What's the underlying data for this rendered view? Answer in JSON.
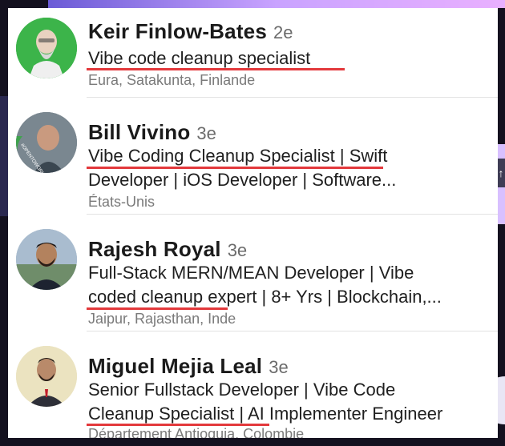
{
  "accent": "#e3393c",
  "results": [
    {
      "name": "Keir Finlow-Bates",
      "degree": "2e",
      "headline": [
        "Vibe code cleanup specialist"
      ],
      "location": "Eura, Satakunta, Finlande",
      "avatar": "bearded-man-green-avatar"
    },
    {
      "name": "Bill Vivino",
      "degree": "3e",
      "headline": [
        "Vibe Coding Cleanup Specialist | Swift",
        "Developer | iOS Developer | Software..."
      ],
      "location": "États-Unis",
      "avatar": "man-open-to-work-avatar",
      "badge": "#OPENTOWORK"
    },
    {
      "name": "Rajesh Royal",
      "degree": "3e",
      "headline": [
        "Full-Stack MERN/MEAN Developer | Vibe",
        "coded cleanup expert | 8+ Yrs | Blockchain,..."
      ],
      "location": "Jaipur, Rajasthan, Inde",
      "avatar": "man-outdoor-avatar"
    },
    {
      "name": "Miguel Mejia Leal",
      "degree": "3e",
      "headline": [
        "Senior Fullstack Developer | Vibe Code",
        "Cleanup Specialist | AI Implementer Engineer"
      ],
      "location": "Département Antioquia, Colombie",
      "avatar": "man-suit-avatar"
    }
  ]
}
